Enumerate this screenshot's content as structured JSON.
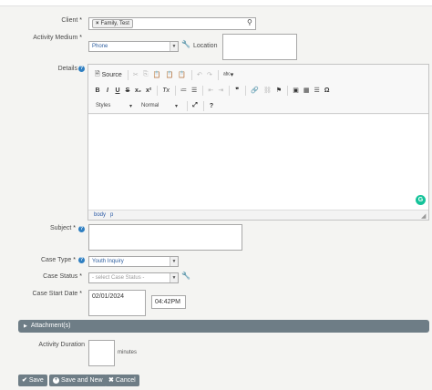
{
  "form": {
    "client": {
      "label": "Client",
      "req": "*",
      "token": "Family, Test"
    },
    "medium": {
      "label": "Activity Medium",
      "req": "*",
      "value": "Phone"
    },
    "location": {
      "label": "Location",
      "value": ""
    },
    "details": {
      "label": "Details"
    },
    "subject": {
      "label": "Subject",
      "req": "*",
      "value": ""
    },
    "case_type": {
      "label": "Case Type",
      "req": "*",
      "value": "Youth Inquiry"
    },
    "case_status": {
      "label": "Case Status",
      "req": "*",
      "value": "- select Case Status -"
    },
    "case_start": {
      "label": "Case Start Date",
      "req": "*",
      "date": "02/01/2024",
      "time": "04:42PM"
    },
    "attachments": {
      "label": "Attachment(s)"
    },
    "duration": {
      "label": "Activity Duration",
      "value": "",
      "unit": "minutes"
    }
  },
  "editor": {
    "source_label": "Source",
    "styles_label": "Styles",
    "format_label": "Normal",
    "path": [
      "body",
      "p"
    ],
    "row2": [
      "B",
      "I",
      "U",
      "S",
      "x₂",
      "x²",
      "Tx"
    ]
  },
  "buttons": {
    "save": "Save",
    "save_new": "Save and New",
    "cancel": "Cancel"
  },
  "colors": {
    "accent": "#6e7d86",
    "help": "#2f7fc1",
    "grammarly": "#15c39a"
  }
}
